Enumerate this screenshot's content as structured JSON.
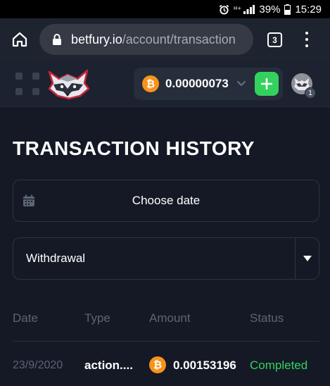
{
  "status_bar": {
    "battery": "39%",
    "time": "15:29",
    "icons": [
      "alarm-icon",
      "signal-icon",
      "battery-icon"
    ]
  },
  "browser": {
    "url_host": "betfury.io",
    "url_path": "/account/transaction",
    "tab_count": "3",
    "icons": [
      "home-icon",
      "lock-icon",
      "tabs-icon",
      "more-vert-icon"
    ]
  },
  "header": {
    "balance": "0.00000073",
    "currency_icon": "bitcoin-icon",
    "notification_count": "1",
    "colors": {
      "accent_green": "#33d25d",
      "bitcoin_orange": "#f7931a"
    }
  },
  "page": {
    "title": "TRANSACTION HISTORY",
    "date_picker_label": "Choose date",
    "type_select_value": "Withdrawal"
  },
  "table": {
    "columns": [
      "Date",
      "Type",
      "Amount",
      "Status"
    ],
    "rows": [
      {
        "date": "23/9/2020",
        "type": "action....",
        "amount": "0.00153196",
        "status": "Completed"
      }
    ]
  }
}
